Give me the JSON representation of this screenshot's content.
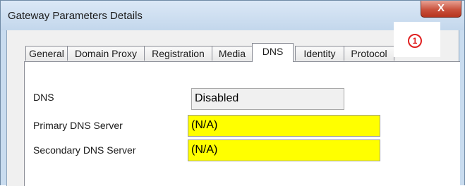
{
  "window": {
    "title": "Gateway Parameters Details",
    "close_label": "X"
  },
  "tabs": [
    {
      "label": "General",
      "active": false
    },
    {
      "label": "Domain Proxy",
      "active": false
    },
    {
      "label": "Registration",
      "active": false
    },
    {
      "label": "Media",
      "active": false
    },
    {
      "label": "DNS",
      "active": true
    },
    {
      "label": "Identity",
      "active": false
    },
    {
      "label": "Protocol",
      "active": false
    }
  ],
  "annotation_marker": "1",
  "dns": {
    "dns_label": "DNS",
    "dns_value": "Disabled",
    "primary_label": "Primary DNS Server",
    "primary_value": "(N/A)",
    "secondary_label": "Secondary DNS Server",
    "secondary_value": "(N/A)"
  },
  "colors": {
    "highlight": "#ffff00",
    "disabled_field": "#f0f0f0",
    "marker": "#e02020"
  }
}
